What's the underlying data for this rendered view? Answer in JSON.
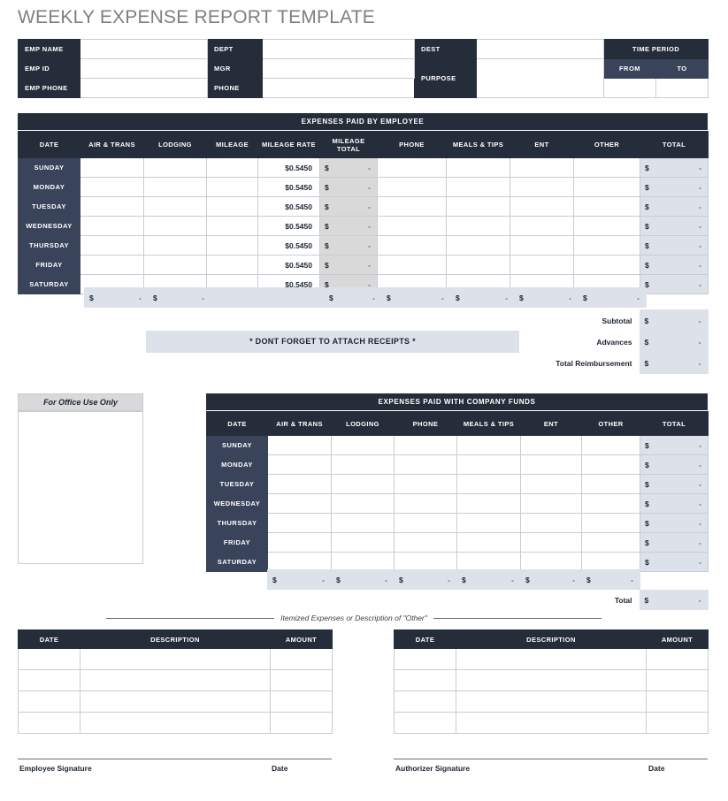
{
  "document": {
    "title": "WEEKLY EXPENSE REPORT TEMPLATE"
  },
  "info_block": {
    "labels": {
      "emp_name": "EMP NAME",
      "emp_id": "EMP ID",
      "emp_phone": "EMP PHONE",
      "dept": "DEPT",
      "mgr": "MGR",
      "phone": "PHONE",
      "dest": "DEST",
      "purpose": "PURPOSE",
      "time_period": "TIME PERIOD",
      "from": "FROM",
      "to": "TO"
    },
    "values": {
      "emp_name": "",
      "emp_id": "",
      "emp_phone": "",
      "dept": "",
      "mgr": "",
      "phone": "",
      "dest": "",
      "purpose": "",
      "from": "",
      "to": ""
    }
  },
  "employee_table": {
    "banner": "EXPENSES PAID BY EMPLOYEE",
    "columns": [
      "DATE",
      "AIR & TRANS",
      "LODGING",
      "MILEAGE",
      "MILEAGE RATE",
      "MILEAGE TOTAL",
      "PHONE",
      "MEALS & TIPS",
      "ENT",
      "OTHER",
      "TOTAL"
    ],
    "mileage_rate": "$0.5450",
    "currency_symbol": "$",
    "empty_value": "-",
    "rows": [
      {
        "day": "SUNDAY",
        "air_trans": "",
        "lodging": "",
        "mileage": "",
        "mileage_rate": "$0.5450",
        "mileage_total": "-",
        "phone": "",
        "meals_tips": "",
        "ent": "",
        "other": "",
        "total": "-"
      },
      {
        "day": "MONDAY",
        "air_trans": "",
        "lodging": "",
        "mileage": "",
        "mileage_rate": "$0.5450",
        "mileage_total": "-",
        "phone": "",
        "meals_tips": "",
        "ent": "",
        "other": "",
        "total": "-"
      },
      {
        "day": "TUESDAY",
        "air_trans": "",
        "lodging": "",
        "mileage": "",
        "mileage_rate": "$0.5450",
        "mileage_total": "-",
        "phone": "",
        "meals_tips": "",
        "ent": "",
        "other": "",
        "total": "-"
      },
      {
        "day": "WEDNESDAY",
        "air_trans": "",
        "lodging": "",
        "mileage": "",
        "mileage_rate": "$0.5450",
        "mileage_total": "-",
        "phone": "",
        "meals_tips": "",
        "ent": "",
        "other": "",
        "total": "-"
      },
      {
        "day": "THURSDAY",
        "air_trans": "",
        "lodging": "",
        "mileage": "",
        "mileage_rate": "$0.5450",
        "mileage_total": "-",
        "phone": "",
        "meals_tips": "",
        "ent": "",
        "other": "",
        "total": "-"
      },
      {
        "day": "FRIDAY",
        "air_trans": "",
        "lodging": "",
        "mileage": "",
        "mileage_rate": "$0.5450",
        "mileage_total": "-",
        "phone": "",
        "meals_tips": "",
        "ent": "",
        "other": "",
        "total": "-"
      },
      {
        "day": "SATURDAY",
        "air_trans": "",
        "lodging": "",
        "mileage": "",
        "mileage_rate": "$0.5450",
        "mileage_total": "-",
        "phone": "",
        "meals_tips": "",
        "ent": "",
        "other": "",
        "total": "-"
      }
    ],
    "subtotal_row": {
      "air_trans": "-",
      "lodging": "-",
      "mileage_total": "-",
      "phone": "-",
      "meals_tips": "-",
      "ent": "-",
      "other": "-"
    }
  },
  "summary": {
    "rows": [
      {
        "label": "Subtotal",
        "currency": "$",
        "value": "-"
      },
      {
        "label": "Advances",
        "currency": "$",
        "value": "-"
      },
      {
        "label": "Total Reimbursement",
        "currency": "$",
        "value": "-"
      }
    ]
  },
  "receipts_notice": "* DONT FORGET TO ATTACH RECEIPTS *",
  "office_use": {
    "header": "For Office Use Only",
    "body": ""
  },
  "company_table": {
    "banner": "EXPENSES PAID WITH COMPANY FUNDS",
    "columns": [
      "DATE",
      "AIR & TRANS",
      "LODGING",
      "PHONE",
      "MEALS & TIPS",
      "ENT",
      "OTHER",
      "TOTAL"
    ],
    "currency_symbol": "$",
    "empty_value": "-",
    "rows": [
      {
        "day": "SUNDAY",
        "air_trans": "",
        "lodging": "",
        "phone": "",
        "meals_tips": "",
        "ent": "",
        "other": "",
        "total": "-"
      },
      {
        "day": "MONDAY",
        "air_trans": "",
        "lodging": "",
        "phone": "",
        "meals_tips": "",
        "ent": "",
        "other": "",
        "total": "-"
      },
      {
        "day": "TUESDAY",
        "air_trans": "",
        "lodging": "",
        "phone": "",
        "meals_tips": "",
        "ent": "",
        "other": "",
        "total": "-"
      },
      {
        "day": "WEDNESDAY",
        "air_trans": "",
        "lodging": "",
        "phone": "",
        "meals_tips": "",
        "ent": "",
        "other": "",
        "total": "-"
      },
      {
        "day": "THURSDAY",
        "air_trans": "",
        "lodging": "",
        "phone": "",
        "meals_tips": "",
        "ent": "",
        "other": "",
        "total": "-"
      },
      {
        "day": "FRIDAY",
        "air_trans": "",
        "lodging": "",
        "phone": "",
        "meals_tips": "",
        "ent": "",
        "other": "",
        "total": "-"
      },
      {
        "day": "SATURDAY",
        "air_trans": "",
        "lodging": "",
        "phone": "",
        "meals_tips": "",
        "ent": "",
        "other": "",
        "total": "-"
      }
    ],
    "subtotal_row": {
      "air_trans": "-",
      "lodging": "-",
      "phone": "-",
      "meals_tips": "-",
      "ent": "-",
      "other": "-"
    },
    "total_row": {
      "label": "Total",
      "currency": "$",
      "value": "-"
    }
  },
  "itemized": {
    "divider_label": "Itemized Expenses or Description of \"Other\"",
    "columns": [
      "DATE",
      "DESCRIPTION",
      "AMOUNT"
    ],
    "left_rows": [
      {
        "date": "",
        "description": "",
        "amount": ""
      },
      {
        "date": "",
        "description": "",
        "amount": ""
      },
      {
        "date": "",
        "description": "",
        "amount": ""
      },
      {
        "date": "",
        "description": "",
        "amount": ""
      }
    ],
    "right_rows": [
      {
        "date": "",
        "description": "",
        "amount": ""
      },
      {
        "date": "",
        "description": "",
        "amount": ""
      },
      {
        "date": "",
        "description": "",
        "amount": ""
      },
      {
        "date": "",
        "description": "",
        "amount": ""
      }
    ]
  },
  "signatures": {
    "employee_label": "Employee Signature",
    "employee_date_label": "Date",
    "authorizer_label": "Authorizer Signature",
    "authorizer_date_label": "Date"
  }
}
